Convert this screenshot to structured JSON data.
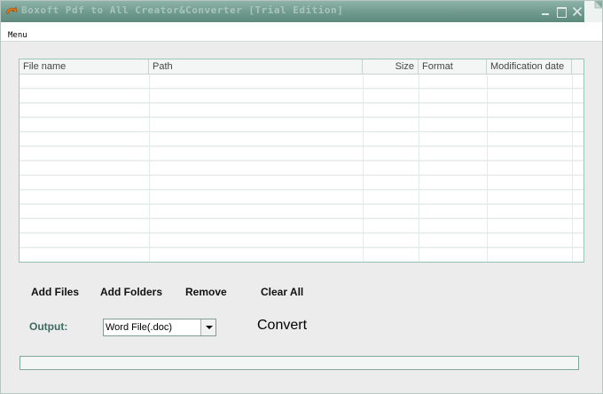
{
  "window": {
    "title": "Boxoft Pdf to All Creator&Converter [Trial Edition]"
  },
  "menubar": {
    "items": [
      {
        "label": "Menu"
      }
    ]
  },
  "file_table": {
    "columns": [
      {
        "label": "File name"
      },
      {
        "label": "Path"
      },
      {
        "label": "Size"
      },
      {
        "label": "Format"
      },
      {
        "label": "Modification date"
      },
      {
        "label": ""
      }
    ],
    "rows": []
  },
  "actions": {
    "add_files": "Add Files",
    "add_folders": "Add Folders",
    "remove": "Remove",
    "clear_all": "Clear All"
  },
  "output": {
    "label": "Output:",
    "selected": "Word File(.doc)"
  },
  "convert": {
    "label": "Convert"
  },
  "progress": {
    "value": 0
  },
  "colors": {
    "titlebar": "#6f9a8d",
    "accent": "#3d6b5f",
    "table_border": "#9fc4b8"
  }
}
